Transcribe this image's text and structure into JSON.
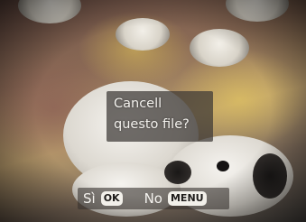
{
  "dialog": {
    "line1": "Cancell",
    "line2": "questo file?"
  },
  "bottom_bar": {
    "yes_label": "Sì",
    "yes_key": "OK",
    "no_label": "No",
    "no_key": "MENU"
  }
}
